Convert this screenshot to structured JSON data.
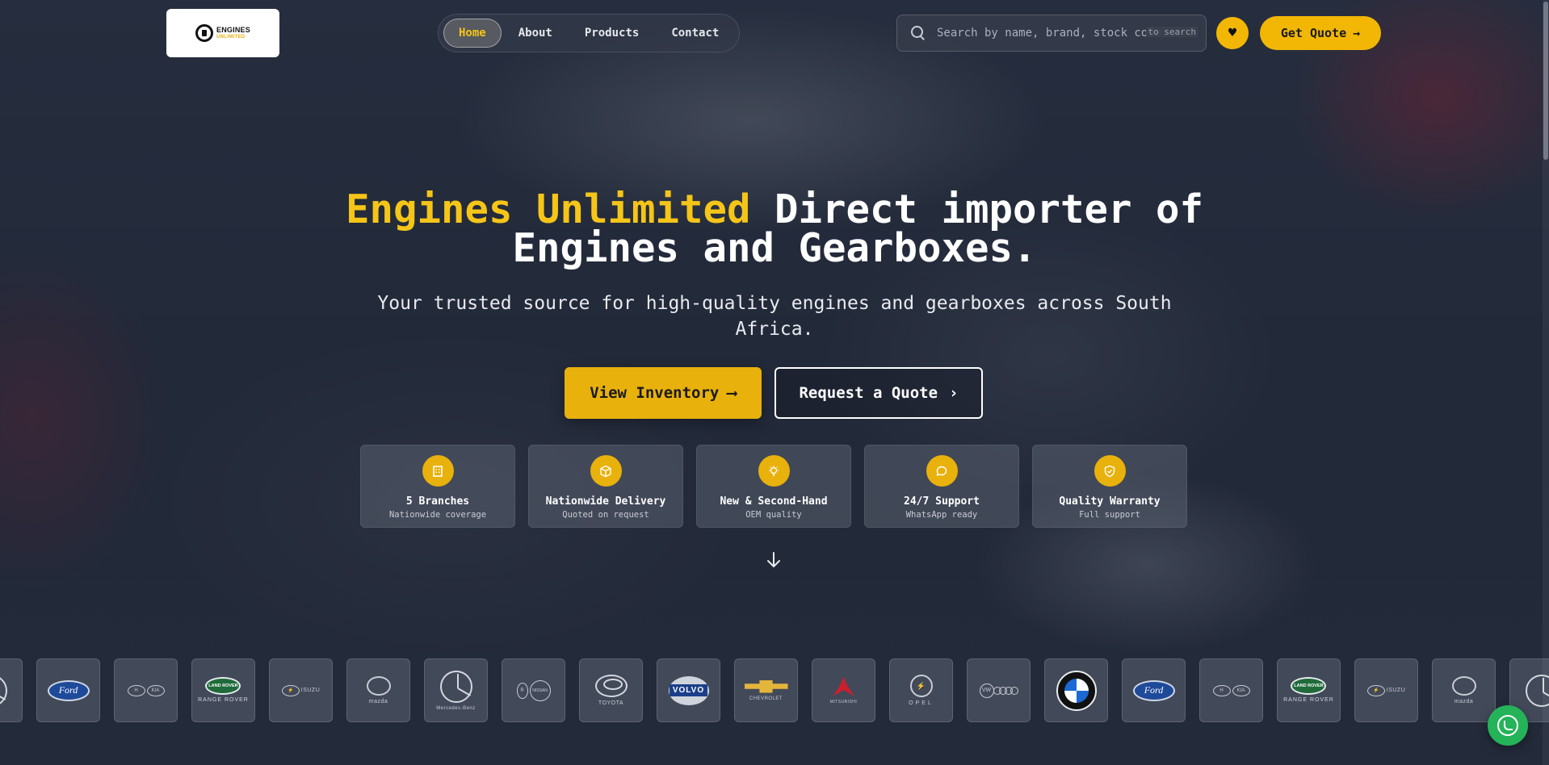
{
  "brand": {
    "logo_line1": "ENGINES",
    "logo_line2": "UNLIMITED",
    "accent_color": "#f5c518",
    "button_color": "#e8b10c"
  },
  "nav": {
    "items": [
      {
        "label": "Home",
        "active": true
      },
      {
        "label": "About",
        "active": false
      },
      {
        "label": "Products",
        "active": false
      },
      {
        "label": "Contact",
        "active": false
      }
    ]
  },
  "search": {
    "placeholder": "Search by name, brand, stock code...",
    "hint": "to search"
  },
  "header": {
    "favorites_icon": "heart-icon",
    "get_quote_label": "Get Quote",
    "get_quote_arrow": "→"
  },
  "hero": {
    "title_highlight": "Engines Unlimited",
    "title_rest": " Direct importer of Engines and Gearboxes.",
    "subtitle": "Your trusted source for high-quality engines and gearboxes across South Africa.",
    "primary_cta": "View Inventory",
    "primary_cta_arrow": "⟶",
    "secondary_cta": "Request a Quote",
    "secondary_cta_arrow": "›"
  },
  "features": [
    {
      "icon": "building-icon",
      "title": "5 Branches",
      "subtitle": "Nationwide coverage"
    },
    {
      "icon": "box-icon",
      "title": "Nationwide Delivery",
      "subtitle": "Quoted on request"
    },
    {
      "icon": "lightbulb-icon",
      "title": "New & Second-Hand",
      "subtitle": "OEM quality"
    },
    {
      "icon": "chat-icon",
      "title": "24/7 Support",
      "subtitle": "WhatsApp ready"
    },
    {
      "icon": "shield-check-icon",
      "title": "Quality Warranty",
      "subtitle": "Full support"
    }
  ],
  "scroll_icon": "arrow-down-icon",
  "brands": [
    "Ford",
    "Hyundai Kia",
    "Land Rover",
    "Opel Isuzu",
    "Mazda",
    "Mercedes-Benz",
    "Renault Nissan",
    "Toyota",
    "Volvo",
    "Chevrolet",
    "Mitsubishi",
    "Opel",
    "VW Audi",
    "BMW",
    "Ford",
    "Hyundai Kia",
    "Land Rover",
    "Opel Isuzu",
    "Mazda",
    "Mercedes-Benz"
  ],
  "brand_text": {
    "ford": "Ford",
    "land_rover": "LAND ROVER",
    "range_rover": "RANGE ROVER",
    "volvo": "VOLVO",
    "opel": "OPEL",
    "mazda": "mazda",
    "isuzu": "ISUZU",
    "hyundai": "H",
    "kia": "KIA",
    "mercedes": "Mercedes-Benz",
    "renault": "R",
    "nissan": "NISSAN",
    "toyota": "TOYOTA",
    "chevrolet": "CHEVROLET",
    "mitsubishi": "MITSUBISHI",
    "vw": "VW",
    "bmw": "BMW"
  },
  "whatsapp_icon": "whatsapp-icon"
}
